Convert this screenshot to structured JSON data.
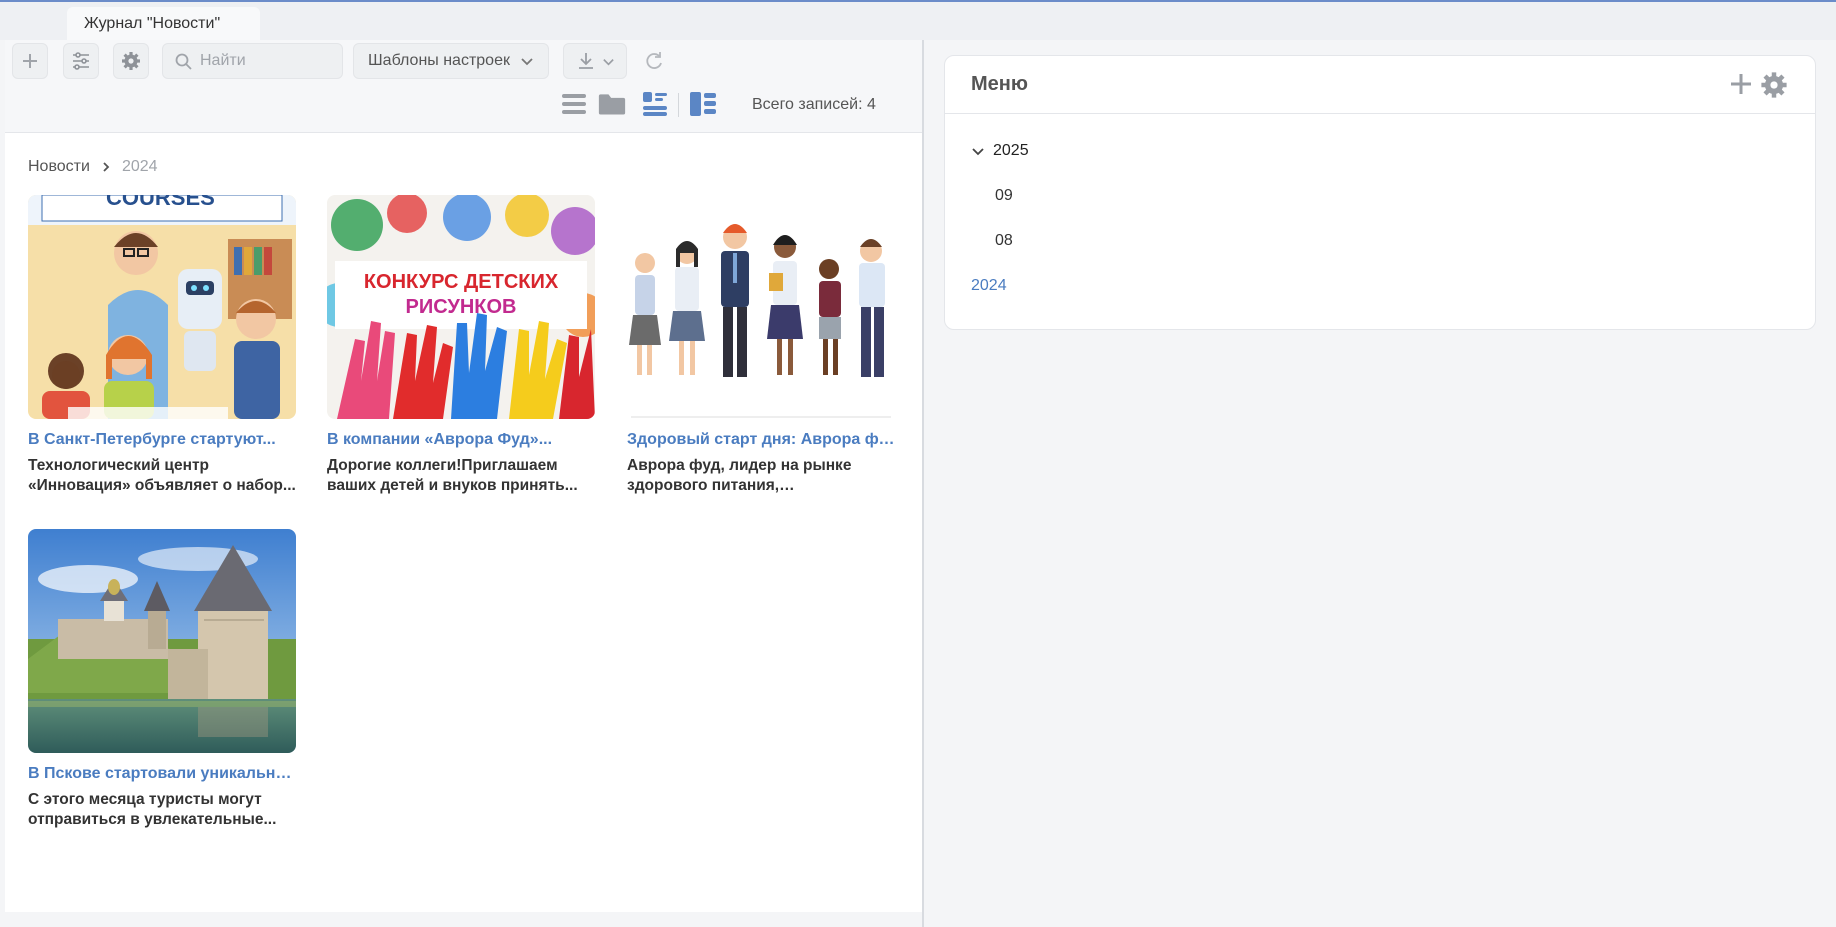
{
  "tab": {
    "title": "Журнал \"Новости\""
  },
  "toolbar": {
    "search_placeholder": "Найти",
    "templates_label": "Шаблоны настроек",
    "total_label": "Всего записей: 4",
    "icons": [
      "plus-icon",
      "filter-sliders-icon",
      "gear-icon",
      "search-icon",
      "chevron-down-icon",
      "download-icon",
      "refresh-icon",
      "list-view-icon",
      "folder-view-icon",
      "card-list-view-icon",
      "tile-view-icon"
    ]
  },
  "breadcrumb": {
    "root": "Новости",
    "current": "2024"
  },
  "cards": [
    {
      "title": "В Санкт-Петербурге стартуют...",
      "desc": "Технологический центр «Инновация» объявляет о набор...",
      "image": "it-courses-illustration"
    },
    {
      "title": "В компании «Аврора Фуд»...",
      "desc": "Дорогие коллеги!Приглашаем ваших детей и внуков принять...",
      "image": "painted-hands-contest"
    },
    {
      "title": "Здоровый старт дня: Аврора фуд...",
      "desc": "Аврора фуд, лидер на рынке здорового питания, представляе...",
      "image": "schoolchildren-illustration"
    },
    {
      "title": "В Пскове стартовали уникальны...",
      "desc": "С этого месяца туристы могут отправиться в увлекательные...",
      "image": "pskov-kremlin-photo"
    }
  ],
  "image_text": {
    "courses": "COURSES",
    "contest_line1": "КОНКУРС ДЕТСКИХ",
    "contest_line2": "РИСУНКОВ"
  },
  "menu": {
    "title": "Меню",
    "tree": [
      {
        "label": "2025",
        "expanded": true,
        "children": [
          {
            "label": "09"
          },
          {
            "label": "08"
          }
        ]
      },
      {
        "label": "2024",
        "active": true
      }
    ]
  },
  "colors": {
    "accent": "#4a7cc0",
    "active_view": "#5b86c5",
    "icon_gray": "#9a9ea4"
  }
}
